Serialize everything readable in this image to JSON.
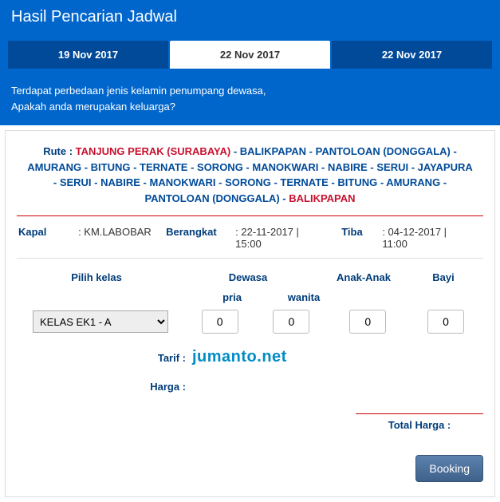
{
  "page_title": "Hasil Pencarian Jadwal",
  "tabs": [
    {
      "label": "19 Nov 2017",
      "active": false
    },
    {
      "label": "22 Nov 2017",
      "active": true
    },
    {
      "label": "22 Nov 2017",
      "active": false
    }
  ],
  "notice_line1": "Terdapat perbedaan jenis kelamin penumpang dewasa,",
  "notice_line2": "Apakah anda merupakan keluarga?",
  "route": {
    "prefix": "Rute :",
    "start": "TANJUNG PERAK (SURABAYA)",
    "mid": " - BALIKPAPAN - PANTOLOAN (DONGGALA) - AMURANG - BITUNG - TERNATE - SORONG - MANOKWARI - NABIRE - SERUI - JAYAPURA - SERUI - NABIRE - MANOKWARI - SORONG - TERNATE - BITUNG - AMURANG - PANTOLOAN (DONGGALA) - ",
    "end": "BALIKPAPAN"
  },
  "info": {
    "kapal_lbl": "Kapal",
    "kapal_val": ": KM.LABOBAR",
    "berangkat_lbl": "Berangkat",
    "berangkat_val": ": 22-11-2017 | 15:00",
    "tiba_lbl": "Tiba",
    "tiba_val": ": 04-12-2017 | 11:00"
  },
  "headers": {
    "kelas": "Pilih kelas",
    "dewasa": "Dewasa",
    "anak": "Anak-Anak",
    "bayi": "Bayi",
    "pria": "pria",
    "wanita": "wanita"
  },
  "kelas_selected": "KELAS EK1 - A",
  "counts": {
    "pria": "0",
    "wanita": "0",
    "anak": "0",
    "bayi": "0"
  },
  "labels": {
    "tarif": "Tarif :",
    "harga": "Harga :",
    "total": "Total Harga :",
    "booking": "Booking"
  },
  "tarif_value": "jumanto.net"
}
